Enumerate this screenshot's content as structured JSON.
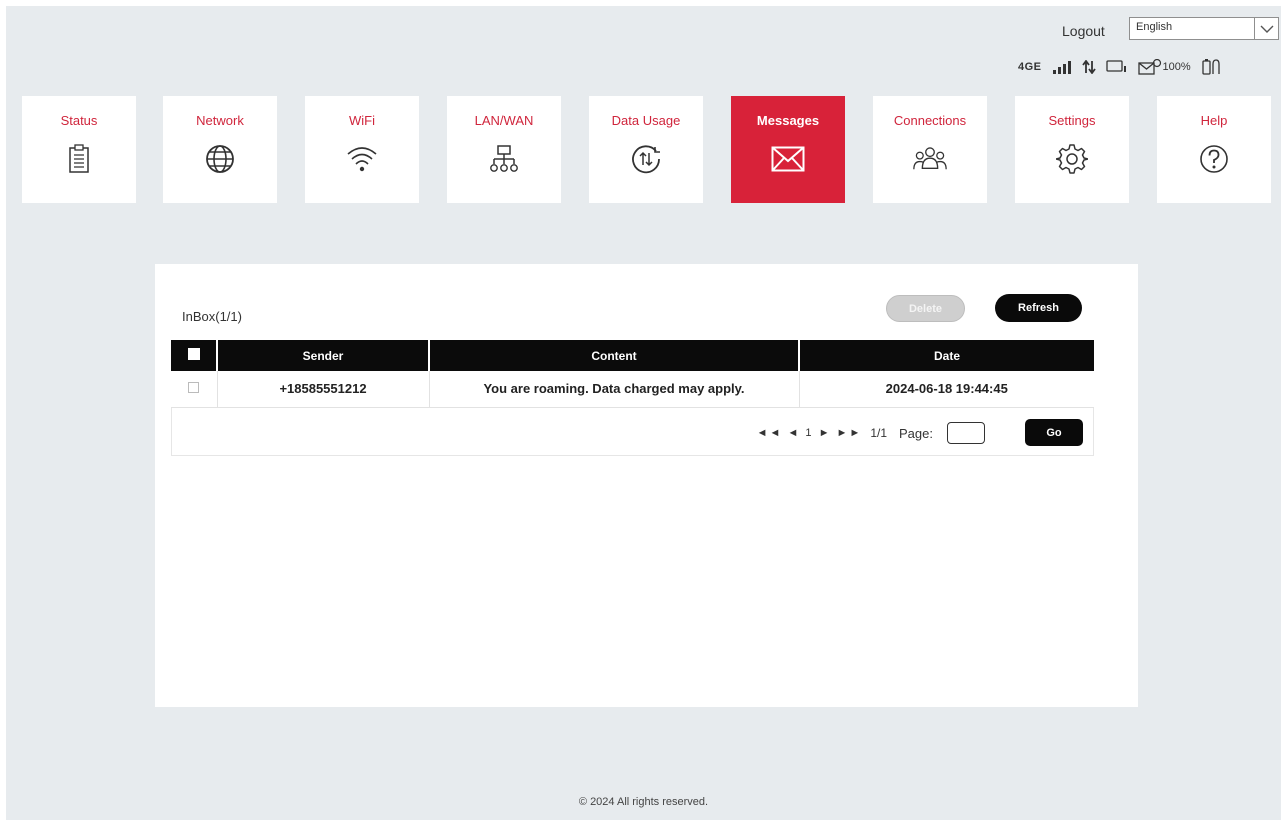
{
  "header": {
    "logout_label": "Logout",
    "language_selected": "English",
    "network_type": "4GE",
    "battery": "100%"
  },
  "nav": {
    "items": [
      {
        "label": "Status",
        "icon": "clipboard-icon"
      },
      {
        "label": "Network",
        "icon": "globe-icon"
      },
      {
        "label": "WiFi",
        "icon": "wifi-icon"
      },
      {
        "label": "LAN/WAN",
        "icon": "lan-icon"
      },
      {
        "label": "Data Usage",
        "icon": "data-usage-icon"
      },
      {
        "label": "Messages",
        "icon": "envelope-icon",
        "active": true
      },
      {
        "label": "Connections",
        "icon": "users-icon"
      },
      {
        "label": "Settings",
        "icon": "gear-icon"
      },
      {
        "label": "Help",
        "icon": "help-icon"
      }
    ]
  },
  "inbox": {
    "title": "InBox(1/1)",
    "delete_label": "Delete",
    "refresh_label": "Refresh",
    "columns": [
      "Sender",
      "Content",
      "Date"
    ],
    "rows": [
      {
        "sender": "+18585551212",
        "content": "You are roaming. Data charged may apply.",
        "date": "2024-06-18 19:44:45"
      }
    ],
    "pager": {
      "arrows": "◄◄ ◄ 1 ► ►►",
      "current": "1/1",
      "page_label": "Page:",
      "go_label": "Go"
    }
  },
  "footer": {
    "copyright": "© 2024 All rights reserved."
  },
  "colors": {
    "accent": "#d82239",
    "background": "#e7ebee",
    "table_header": "#0b0b0b"
  }
}
